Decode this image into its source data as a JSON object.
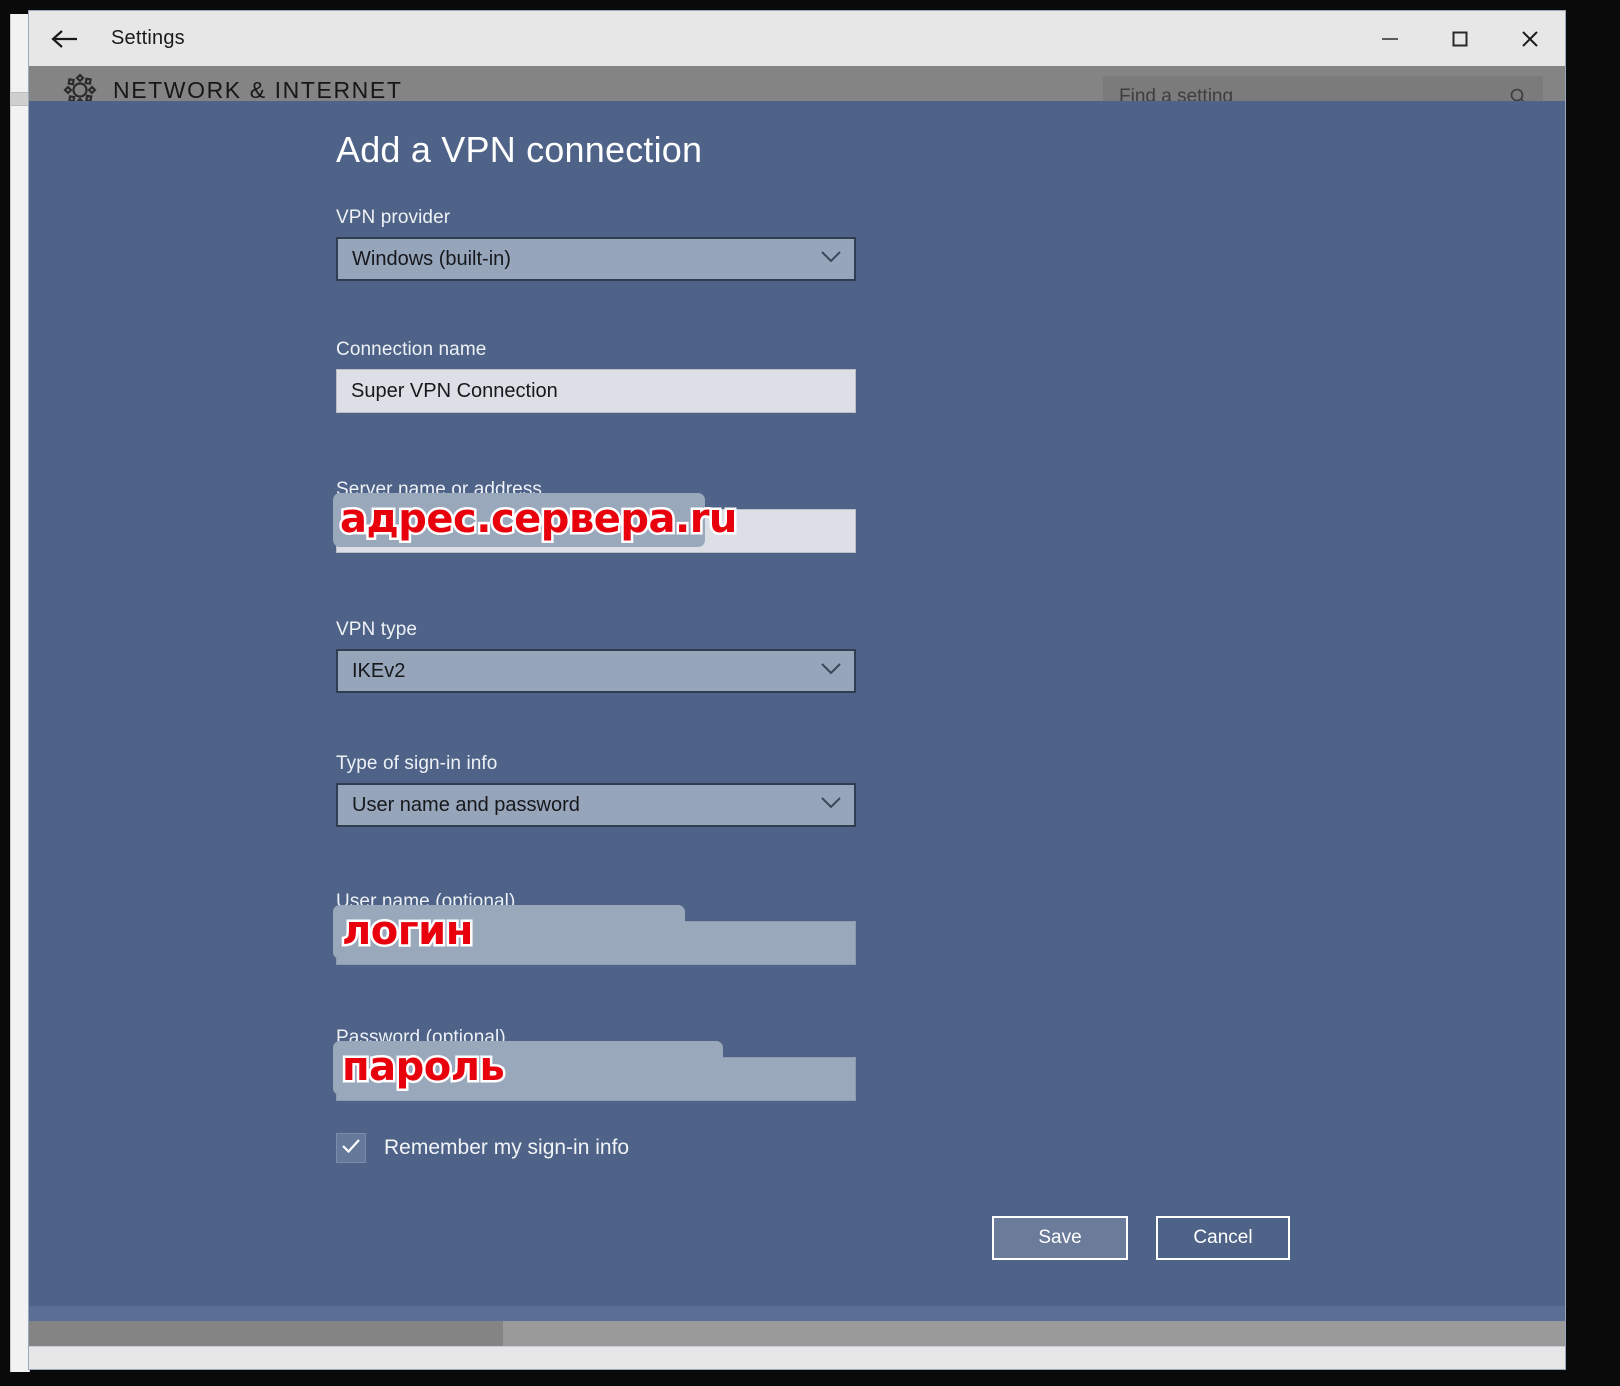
{
  "window": {
    "title": "Settings",
    "back_icon": "back-arrow-icon",
    "minimize_icon": "minimize-icon",
    "maximize_icon": "maximize-icon",
    "close_icon": "close-icon"
  },
  "header": {
    "gear_icon": "gear-icon",
    "heading": "NETWORK & INTERNET",
    "search_placeholder": "Find a setting",
    "search_icon": "search-icon"
  },
  "dialog": {
    "title": "Add a VPN connection",
    "fields": {
      "provider": {
        "label": "VPN provider",
        "value": "Windows (built-in)",
        "chevron_icon": "chevron-down-icon"
      },
      "connection_name": {
        "label": "Connection name",
        "value": "Super VPN Connection"
      },
      "server": {
        "label": "Server name or address",
        "value": "",
        "annotation": "адрес.сервера.ru"
      },
      "vpn_type": {
        "label": "VPN type",
        "value": "IKEv2",
        "chevron_icon": "chevron-down-icon"
      },
      "signin_type": {
        "label": "Type of sign-in info",
        "value": "User name and password",
        "chevron_icon": "chevron-down-icon"
      },
      "username": {
        "label": "User name (optional)",
        "value": "",
        "annotation": "логин"
      },
      "password": {
        "label": "Password (optional)",
        "value": "",
        "annotation": "пароль"
      }
    },
    "remember": {
      "label": "Remember my sign-in info",
      "checked": true,
      "check_icon": "check-icon"
    },
    "buttons": {
      "save": "Save",
      "cancel": "Cancel"
    }
  },
  "colors": {
    "overlay_bg": "#4e6387",
    "combo_bg": "#96a5ba",
    "input_bg": "#dcdfe6",
    "annotation_red": "#e8000d",
    "titlebar_bg": "#e7e7e7",
    "header_bg": "#848484"
  }
}
